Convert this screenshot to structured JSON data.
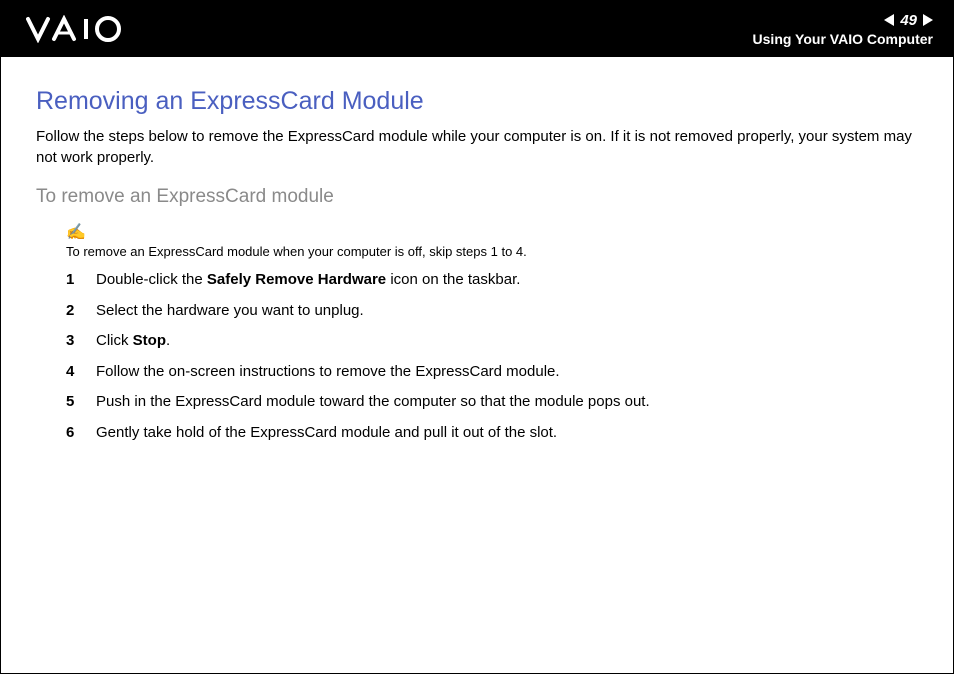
{
  "header": {
    "page_number": "49",
    "section_title": "Using Your VAIO Computer"
  },
  "content": {
    "heading": "Removing an ExpressCard Module",
    "intro": "Follow the steps below to remove the ExpressCard module while your computer is on. If it is not removed properly, your system may not work properly.",
    "sub_heading": "To remove an ExpressCard module",
    "note": "To remove an ExpressCard module when your computer is off, skip steps 1 to 4.",
    "steps": {
      "s1_pre": "Double-click the ",
      "s1_bold": "Safely Remove Hardware",
      "s1_post": " icon on the taskbar.",
      "s2": "Select the hardware you want to unplug.",
      "s3_pre": "Click ",
      "s3_bold": "Stop",
      "s3_post": ".",
      "s4": "Follow the on-screen instructions to remove the ExpressCard module.",
      "s5": "Push in the ExpressCard module toward the computer so that the module pops out.",
      "s6": "Gently take hold of the ExpressCard module and pull it out of the slot."
    }
  }
}
